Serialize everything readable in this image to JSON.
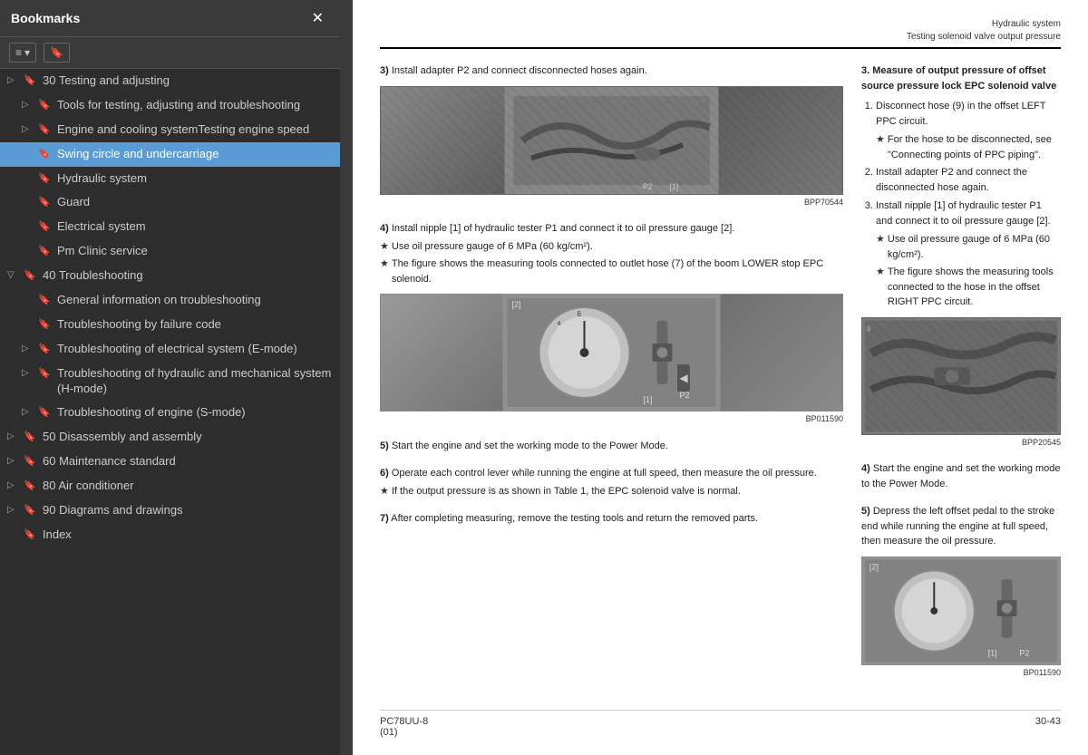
{
  "sidebar": {
    "title": "Bookmarks",
    "close_label": "✕",
    "toolbar": {
      "list_icon": "≡▾",
      "bookmark_icon": "🔖"
    },
    "items": [
      {
        "id": "testing-adjusting",
        "label": "30 Testing and adjusting",
        "level": 0,
        "expanded": false,
        "has_children": true,
        "active": false,
        "truncated": true
      },
      {
        "id": "tools",
        "label": "Tools for testing, adjusting and troubleshooting",
        "level": 1,
        "expanded": false,
        "has_children": true,
        "active": false
      },
      {
        "id": "engine-cooling",
        "label": "Engine and cooling systemTesting engine speed",
        "level": 1,
        "expanded": false,
        "has_children": true,
        "active": false
      },
      {
        "id": "swing-circle",
        "label": "Swing circle and undercarriage",
        "level": 1,
        "expanded": false,
        "has_children": false,
        "active": true
      },
      {
        "id": "hydraulic",
        "label": "Hydraulic system",
        "level": 1,
        "expanded": false,
        "has_children": false,
        "active": false
      },
      {
        "id": "guard",
        "label": "Guard",
        "level": 1,
        "expanded": false,
        "has_children": false,
        "active": false
      },
      {
        "id": "electrical",
        "label": "Electrical system",
        "level": 1,
        "expanded": false,
        "has_children": false,
        "active": false
      },
      {
        "id": "pm-clinic",
        "label": "Pm Clinic service",
        "level": 1,
        "expanded": false,
        "has_children": false,
        "active": false
      },
      {
        "id": "troubleshooting",
        "label": "40 Troubleshooting",
        "level": 0,
        "expanded": true,
        "has_children": true,
        "active": false
      },
      {
        "id": "general-info",
        "label": "General information on troubleshooting",
        "level": 1,
        "expanded": false,
        "has_children": false,
        "active": false
      },
      {
        "id": "failure-code",
        "label": "Troubleshooting by failure code",
        "level": 1,
        "expanded": false,
        "has_children": false,
        "active": false
      },
      {
        "id": "electrical-system-mode",
        "label": "Troubleshooting of electrical system (E-mode)",
        "level": 1,
        "expanded": false,
        "has_children": true,
        "active": false
      },
      {
        "id": "hydraulic-mode",
        "label": "Troubleshooting of hydraulic and mechanical system (H-mode)",
        "level": 1,
        "expanded": false,
        "has_children": true,
        "active": false
      },
      {
        "id": "engine-mode",
        "label": "Troubleshooting of engine (S-mode)",
        "level": 1,
        "expanded": false,
        "has_children": true,
        "active": false
      },
      {
        "id": "disassembly",
        "label": "50 Disassembly and assembly",
        "level": 0,
        "expanded": false,
        "has_children": false,
        "active": false
      },
      {
        "id": "maintenance",
        "label": "60 Maintenance standard",
        "level": 0,
        "expanded": false,
        "has_children": false,
        "active": false
      },
      {
        "id": "air-conditioner",
        "label": "80 Air conditioner",
        "level": 0,
        "expanded": false,
        "has_children": false,
        "active": false
      },
      {
        "id": "diagrams",
        "label": "90 Diagrams and drawings",
        "level": 0,
        "expanded": false,
        "has_children": false,
        "active": false
      },
      {
        "id": "index",
        "label": "Index",
        "level": 0,
        "expanded": false,
        "has_children": false,
        "active": false
      }
    ]
  },
  "page": {
    "header_line1": "Hydraulic system",
    "header_line2": "Testing solenoid valve output pressure",
    "footer_left": "PC78UU-8\n(01)",
    "footer_right": "30-43"
  },
  "content": {
    "step3": {
      "num": "3)",
      "text": "Install adapter P2 and connect disconnected hoses again.",
      "image_code": "BPP70544"
    },
    "measure_step": {
      "num": "3.",
      "title": "Measure of output pressure of offset source pressure lock EPC solenoid valve",
      "steps": [
        {
          "num": "1)",
          "text": "Disconnect hose (9) in the offset LEFT PPC circuit."
        },
        {
          "num": "",
          "star": true,
          "text": "For the hose to be disconnected, see \"Connecting points of PPC piping\"."
        },
        {
          "num": "2)",
          "text": "Install adapter P2 and connect the disconnected hose again."
        },
        {
          "num": "3)",
          "text": "Install nipple [1] of hydraulic tester P1 and connect it to oil pressure gauge [2]."
        },
        {
          "num": "",
          "star": true,
          "text": "Use oil pressure gauge of 6 MPa (60 kg/cm²)."
        },
        {
          "num": "",
          "star": true,
          "text": "The figure shows the measuring tools connected to the hose in the offset RIGHT PPC circuit."
        }
      ],
      "image_code": "BPP20545"
    },
    "step4": {
      "num": "4)",
      "text": "Install nipple [1] of hydraulic tester P1 and connect it to oil pressure gauge [2].",
      "star1": "Use oil pressure gauge of 6 MPa (60 kg/cm²).",
      "star2": "The figure shows the measuring tools connected to outlet hose (7) of the boom LOWER stop EPC solenoid.",
      "image_code": "BP011590"
    },
    "step5": {
      "num": "5)",
      "text": "Start the engine and set the working mode to the Power Mode."
    },
    "step6": {
      "num": "6)",
      "text": "Operate each control lever while running the engine at full speed, then measure the oil pressure.",
      "star": "If the output pressure is as shown in Table 1, the EPC solenoid valve is normal."
    },
    "step7": {
      "num": "7)",
      "text": "After completing measuring, remove the testing tools and return the removed parts."
    },
    "right_step4": {
      "num": "4)",
      "text": "Start the engine and set the working mode to the Power Mode."
    },
    "right_step5": {
      "num": "5)",
      "text": "Depress the left offset pedal to the stroke end while running the engine at full speed, then measure the oil pressure.",
      "image_code": "BP011590"
    }
  }
}
